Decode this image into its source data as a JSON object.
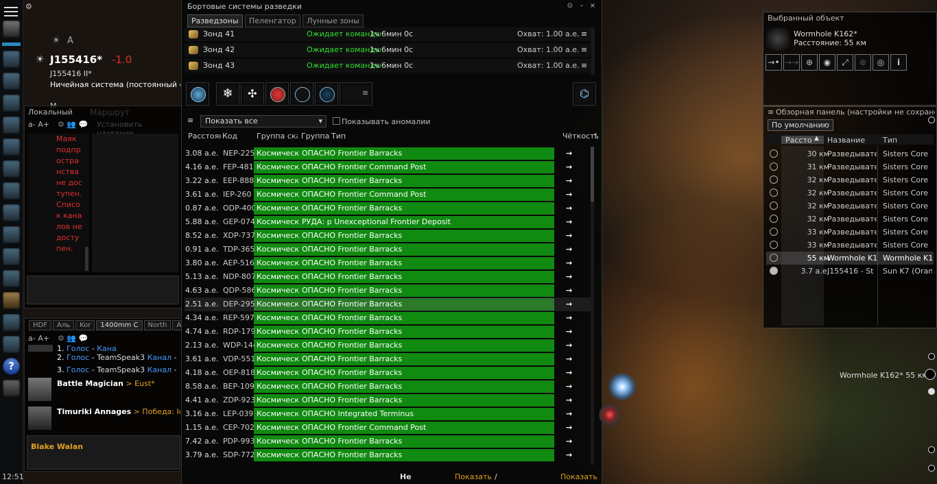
{
  "hud": {
    "clock": "12:51",
    "system_name": "J155416*",
    "security": "-1.0",
    "constellation": "J155416 II*",
    "region": "Ничейная система (постоянный ст",
    "top_label": "A",
    "route_label": "М"
  },
  "local_chat": {
    "title": "Локальный",
    "font_controls": "a- A+",
    "error_text": "Маяк подпространства не доступен. Список каналов не доступен.",
    "bg_hint": "Установить название"
  },
  "chat2": {
    "tabs": [
      "HDF",
      "Аль",
      "Kor",
      "1400mm C",
      "North",
      "Аль"
    ],
    "font_controls": "a- A+",
    "lines": [
      {
        "num": "1.",
        "a": "Голос",
        "b": " - ",
        "c": "Кана",
        "d": "Канал"
      },
      {
        "num": "2.",
        "a": "Голос",
        "b": " - TeamSpeak3 ",
        "c": "",
        "d": "Канал"
      },
      {
        "num": "3.",
        "a": "Голос",
        "b": " - TeamSpeak3 ",
        "c": "",
        "d": "Канал"
      }
    ],
    "messages": [
      {
        "name": "Battle Magician",
        "arrow": " > ",
        "target": "Eust*"
      },
      {
        "name": "Timuriki Annages",
        "arrow": " > ",
        "target": "Победа: Ice A"
      }
    ],
    "footer_name": "Blake Walan"
  },
  "probe_window": {
    "title": "Бортовые системы разведки",
    "tabs": [
      "Разведзоны",
      "Пеленгатор",
      "Лунные зоны"
    ],
    "probes": [
      {
        "name": "Зонд 41",
        "status": "Ожидает команды",
        "time": "1ч 6мин 0с",
        "range": "Охват: 1.00 а.е."
      },
      {
        "name": "Зонд 42",
        "status": "Ожидает команды",
        "time": "1ч 6мин 0с",
        "range": "Охват: 1.00 а.е."
      },
      {
        "name": "Зонд 43",
        "status": "Ожидает команды",
        "time": "1ч 6мин 0с",
        "range": "Охват: 1.00 а.е."
      }
    ],
    "filter": "Показать все",
    "show_anomalies": "Показывать аномалии",
    "columns": [
      "Расстоян",
      "Код",
      "Группа скан",
      "Группа",
      "Тип",
      "Чёткость"
    ],
    "footer_left": "Не",
    "footer_mid": "Показать",
    "footer_sep": "/",
    "footer_right": "Показать",
    "results": [
      {
        "dist": "3.08 а.е.",
        "code": "NEP-225",
        "group": "Космическая",
        "name": "ОПАСНО Frontier Barracks"
      },
      {
        "dist": "4.16 а.е.",
        "code": "FEP-481",
        "group": "Космическая",
        "name": "ОПАСНО Frontier Command Post"
      },
      {
        "dist": "3.22 а.е.",
        "code": "EEP-888",
        "group": "Космическая",
        "name": "ОПАСНО Frontier Barracks"
      },
      {
        "dist": "3.61 а.е.",
        "code": "IEP-260",
        "group": "Космическая",
        "name": "ОПАСНО Frontier Command Post"
      },
      {
        "dist": "0.87 а.е.",
        "code": "ODP-400",
        "group": "Космическая",
        "name": "ОПАСНО Frontier Barracks"
      },
      {
        "dist": "5.88 а.е.",
        "code": "GEP-074",
        "group": "Космическая",
        "name": "РУДА: р Unexceptional Frontier Deposit"
      },
      {
        "dist": "8.52 а.е.",
        "code": "XDP-737",
        "group": "Космическая",
        "name": "ОПАСНО Frontier Barracks"
      },
      {
        "dist": "0.91 а.е.",
        "code": "TDP-365",
        "group": "Космическая",
        "name": "ОПАСНО Frontier Barracks"
      },
      {
        "dist": "3.80 а.е.",
        "code": "AEP-516",
        "group": "Космическая",
        "name": "ОПАСНО Frontier Barracks"
      },
      {
        "dist": "5.13 а.е.",
        "code": "NDP-807",
        "group": "Космическая",
        "name": "ОПАСНО Frontier Barracks"
      },
      {
        "dist": "4.63 а.е.",
        "code": "QDP-586",
        "group": "Космическая",
        "name": "ОПАСНО Frontier Barracks"
      },
      {
        "dist": "2.51 а.е.",
        "code": "DEP-295",
        "group": "Космическая",
        "name": "ОПАСНО Frontier Barracks"
      },
      {
        "dist": "4.34 а.е.",
        "code": "REP-597",
        "group": "Космическая",
        "name": "ОПАСНО Frontier Barracks"
      },
      {
        "dist": "4.74 а.е.",
        "code": "RDP-179",
        "group": "Космическая",
        "name": "ОПАСНО Frontier Barracks"
      },
      {
        "dist": "2.13 а.е.",
        "code": "WDP-144",
        "group": "Космическая",
        "name": "ОПАСНО Frontier Barracks"
      },
      {
        "dist": "3.61 а.е.",
        "code": "VDP-551",
        "group": "Космическая",
        "name": "ОПАСНО Frontier Barracks"
      },
      {
        "dist": "4.18 а.е.",
        "code": "OEP-818",
        "group": "Космическая",
        "name": "ОПАСНО Frontier Barracks"
      },
      {
        "dist": "8.58 а.е.",
        "code": "BEP-109",
        "group": "Космическая",
        "name": "ОПАСНО Frontier Barracks"
      },
      {
        "dist": "4.41 а.е.",
        "code": "ZDP-923",
        "group": "Космическая",
        "name": "ОПАСНО Frontier Barracks"
      },
      {
        "dist": "3.16 а.е.",
        "code": "LEP-039",
        "group": "Космическая",
        "name": "ОПАСНО Integrated Terminus"
      },
      {
        "dist": "1.15 а.е.",
        "code": "CEP-702",
        "group": "Космическая",
        "name": "ОПАСНО Frontier Command Post"
      },
      {
        "dist": "7.42 а.е.",
        "code": "PDP-993",
        "group": "Космическая",
        "name": "ОПАСНО Frontier Barracks"
      },
      {
        "dist": "3.79 а.е.",
        "code": "SDP-772",
        "group": "Космическая",
        "name": "ОПАСНО Frontier Barracks"
      }
    ]
  },
  "selected_item": {
    "title": "Выбранный объект",
    "name": "Wormhole K162*",
    "distance": "Расстояние: 55 км",
    "info_label": "i"
  },
  "overview": {
    "title": "Обзорная панель (настройки не сохранены",
    "tab": "По умолчанию",
    "columns": [
      "Рассто",
      "Название",
      "Тип"
    ],
    "rows": [
      {
        "dist": "30 км",
        "name": "Разведывате",
        "type": "Sisters Core"
      },
      {
        "dist": "31 км",
        "name": "Разведывате",
        "type": "Sisters Core"
      },
      {
        "dist": "32 км",
        "name": "Разведывате",
        "type": "Sisters Core"
      },
      {
        "dist": "32 км",
        "name": "Разведывате",
        "type": "Sisters Core"
      },
      {
        "dist": "32 км",
        "name": "Разведывате",
        "type": "Sisters Core"
      },
      {
        "dist": "32 км",
        "name": "Разведывате",
        "type": "Sisters Core"
      },
      {
        "dist": "33 км",
        "name": "Разведывате",
        "type": "Sisters Core"
      },
      {
        "dist": "33 км",
        "name": "Разведывате",
        "type": "Sisters Core"
      },
      {
        "dist": "55 км",
        "name": "Wormhole K1",
        "type": "Wormhole K1"
      },
      {
        "dist": "3.7 а.е.",
        "name": "J155416 - St",
        "type": "Sun K7 (Oran"
      }
    ]
  },
  "space_bracket": {
    "label": "Wormhole K162* 55 км"
  }
}
